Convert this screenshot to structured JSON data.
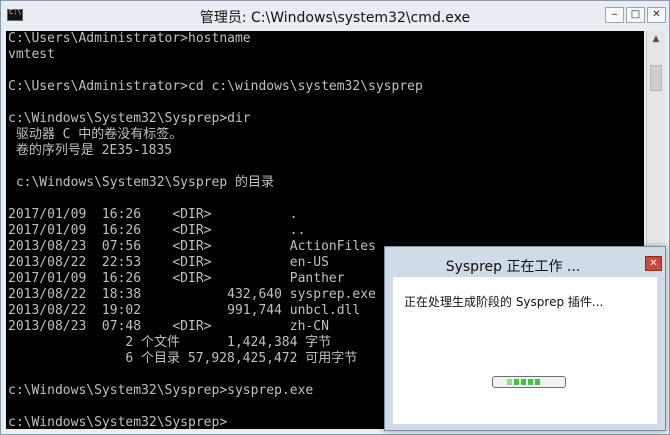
{
  "window": {
    "title": "管理员: C:\\Windows\\system32\\cmd.exe",
    "minimize_glyph": "‒",
    "maximize_glyph": "□",
    "close_glyph": "✕"
  },
  "console_lines": [
    "C:\\Users\\Administrator>hostname",
    "vmtest",
    "",
    "C:\\Users\\Administrator>cd c:\\windows\\system32\\sysprep",
    "",
    "c:\\Windows\\System32\\Sysprep>dir",
    " 驱动器 C 中的卷没有标签。",
    " 卷的序列号是 2E35-1835",
    "",
    " c:\\Windows\\System32\\Sysprep 的目录",
    "",
    "2017/01/09  16:26    <DIR>          .",
    "2017/01/09  16:26    <DIR>          ..",
    "2013/08/23  07:56    <DIR>          ActionFiles",
    "2013/08/22  22:53    <DIR>          en-US",
    "2017/01/09  16:26    <DIR>          Panther",
    "2013/08/22  18:38           432,640 sysprep.exe",
    "2013/08/22  19:02           991,744 unbcl.dll",
    "2013/08/23  07:48    <DIR>          zh-CN",
    "               2 个文件      1,424,384 字节",
    "               6 个目录 57,928,425,472 可用字节",
    "",
    "c:\\Windows\\System32\\Sysprep>sysprep.exe",
    "",
    "c:\\Windows\\System32\\Sysprep>"
  ],
  "scrollbar": {
    "up_glyph": "▲"
  },
  "dialog": {
    "title": "Sysprep 正在工作 ...",
    "close_glyph": "✕",
    "message": "正在处理生成阶段的 Sysprep 插件..."
  },
  "colors": {
    "console_bg": "#000000",
    "console_text": "#c0c0c0",
    "progress_green": "#46c04a",
    "close_red": "#c64b3c"
  }
}
